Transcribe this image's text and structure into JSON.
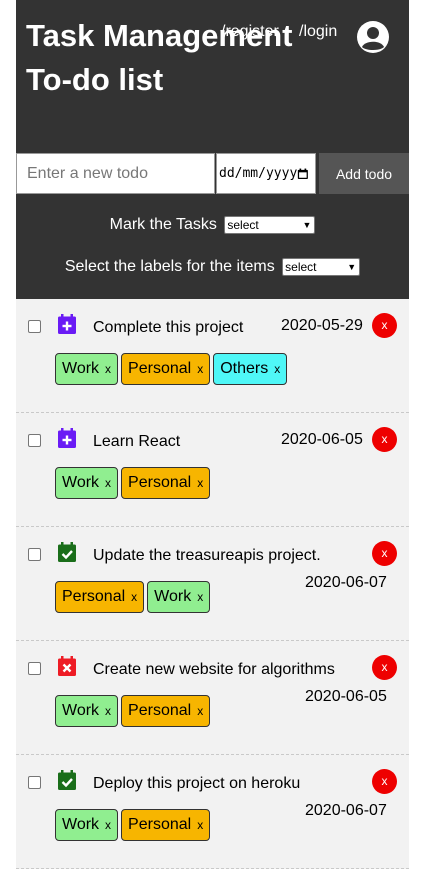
{
  "header": {
    "title": "Task Management To-do list",
    "register_link": "/register",
    "login_link": "/login"
  },
  "form": {
    "todo_placeholder": "Enter a new todo",
    "date_placeholder": "dd/mm/yyyy",
    "add_button": "Add todo"
  },
  "controls": {
    "mark_label": "Mark the Tasks",
    "mark_select": "select",
    "labels_label": "Select the labels for the items",
    "labels_select": "select"
  },
  "todos": [
    {
      "text": "Complete this project",
      "date": "2020-05-29",
      "status_icon": "calendar-plus-icon",
      "delete": "x",
      "labels": [
        {
          "name": "Work",
          "x": "x"
        },
        {
          "name": "Personal",
          "x": "x"
        },
        {
          "name": "Others",
          "x": "x"
        }
      ]
    },
    {
      "text": "Learn React",
      "date": "2020-06-05",
      "status_icon": "calendar-plus-icon",
      "delete": "x",
      "labels": [
        {
          "name": "Work",
          "x": "x"
        },
        {
          "name": "Personal",
          "x": "x"
        }
      ]
    },
    {
      "text": "Update the treasureapis project.",
      "date": "2020-06-07",
      "status_icon": "calendar-check-icon",
      "delete": "x",
      "labels": [
        {
          "name": "Personal",
          "x": "x"
        },
        {
          "name": "Work",
          "x": "x"
        }
      ]
    },
    {
      "text": "Create new website for algorithms",
      "date": "2020-06-05",
      "status_icon": "calendar-times-icon",
      "delete": "x",
      "labels": [
        {
          "name": "Work",
          "x": "x"
        },
        {
          "name": "Personal",
          "x": "x"
        }
      ]
    },
    {
      "text": "Deploy this project on heroku",
      "date": "2020-06-07",
      "status_icon": "calendar-check-icon",
      "delete": "x",
      "labels": [
        {
          "name": "Work",
          "x": "x"
        },
        {
          "name": "Personal",
          "x": "x"
        }
      ]
    }
  ],
  "colors": {
    "header_bg": "#333333",
    "list_bg": "#f2f2f2",
    "delete_button": "#ee0000",
    "tag_work": "#90ee90",
    "tag_personal": "#f7b500",
    "tag_others": "#4ff7f7",
    "icon_plus": "#6a1bf5",
    "icon_check": "#1a6e1a",
    "icon_times": "#ee1c25"
  }
}
